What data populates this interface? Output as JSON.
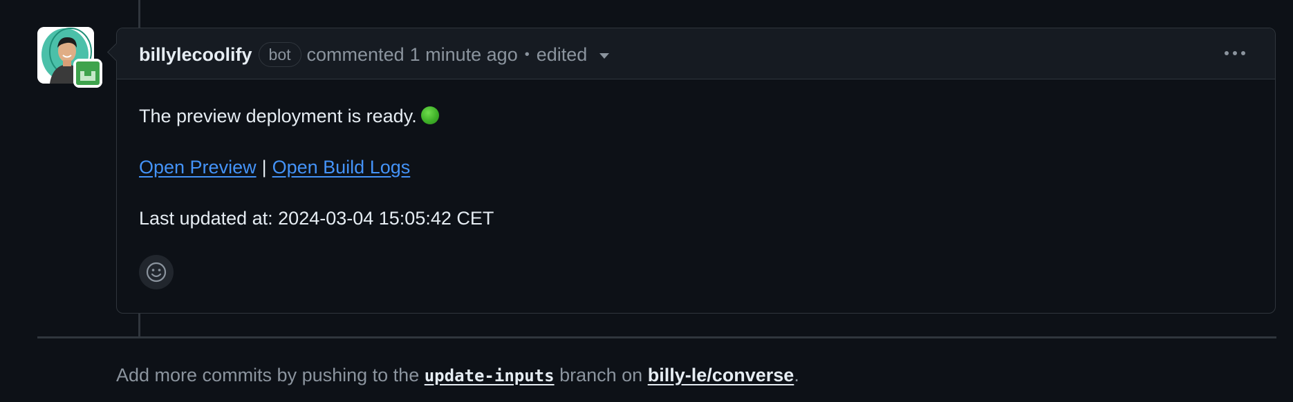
{
  "comment": {
    "author": "billylecoolify",
    "badge": "bot",
    "action": "commented",
    "time": "1 minute ago",
    "separator": "•",
    "edited_label": "edited",
    "body": {
      "status_line": "The preview deployment is ready.",
      "status_emoji": "green-circle",
      "links": [
        {
          "label": "Open Preview"
        },
        {
          "label": "Open Build Logs"
        }
      ],
      "link_separator": "|",
      "updated_line": "Last updated at: 2024-03-04 15:05:42 CET"
    }
  },
  "footer": {
    "prefix": "Add more commits by pushing to the",
    "branch": "update-inputs",
    "middle": "branch on",
    "repo": "billy-le/converse",
    "suffix": "."
  },
  "colors": {
    "background": "#0d1117",
    "header_bg": "#161b22",
    "border": "#30363d",
    "link": "#4493f8",
    "muted": "#8b949e",
    "text": "#e6edf3"
  }
}
